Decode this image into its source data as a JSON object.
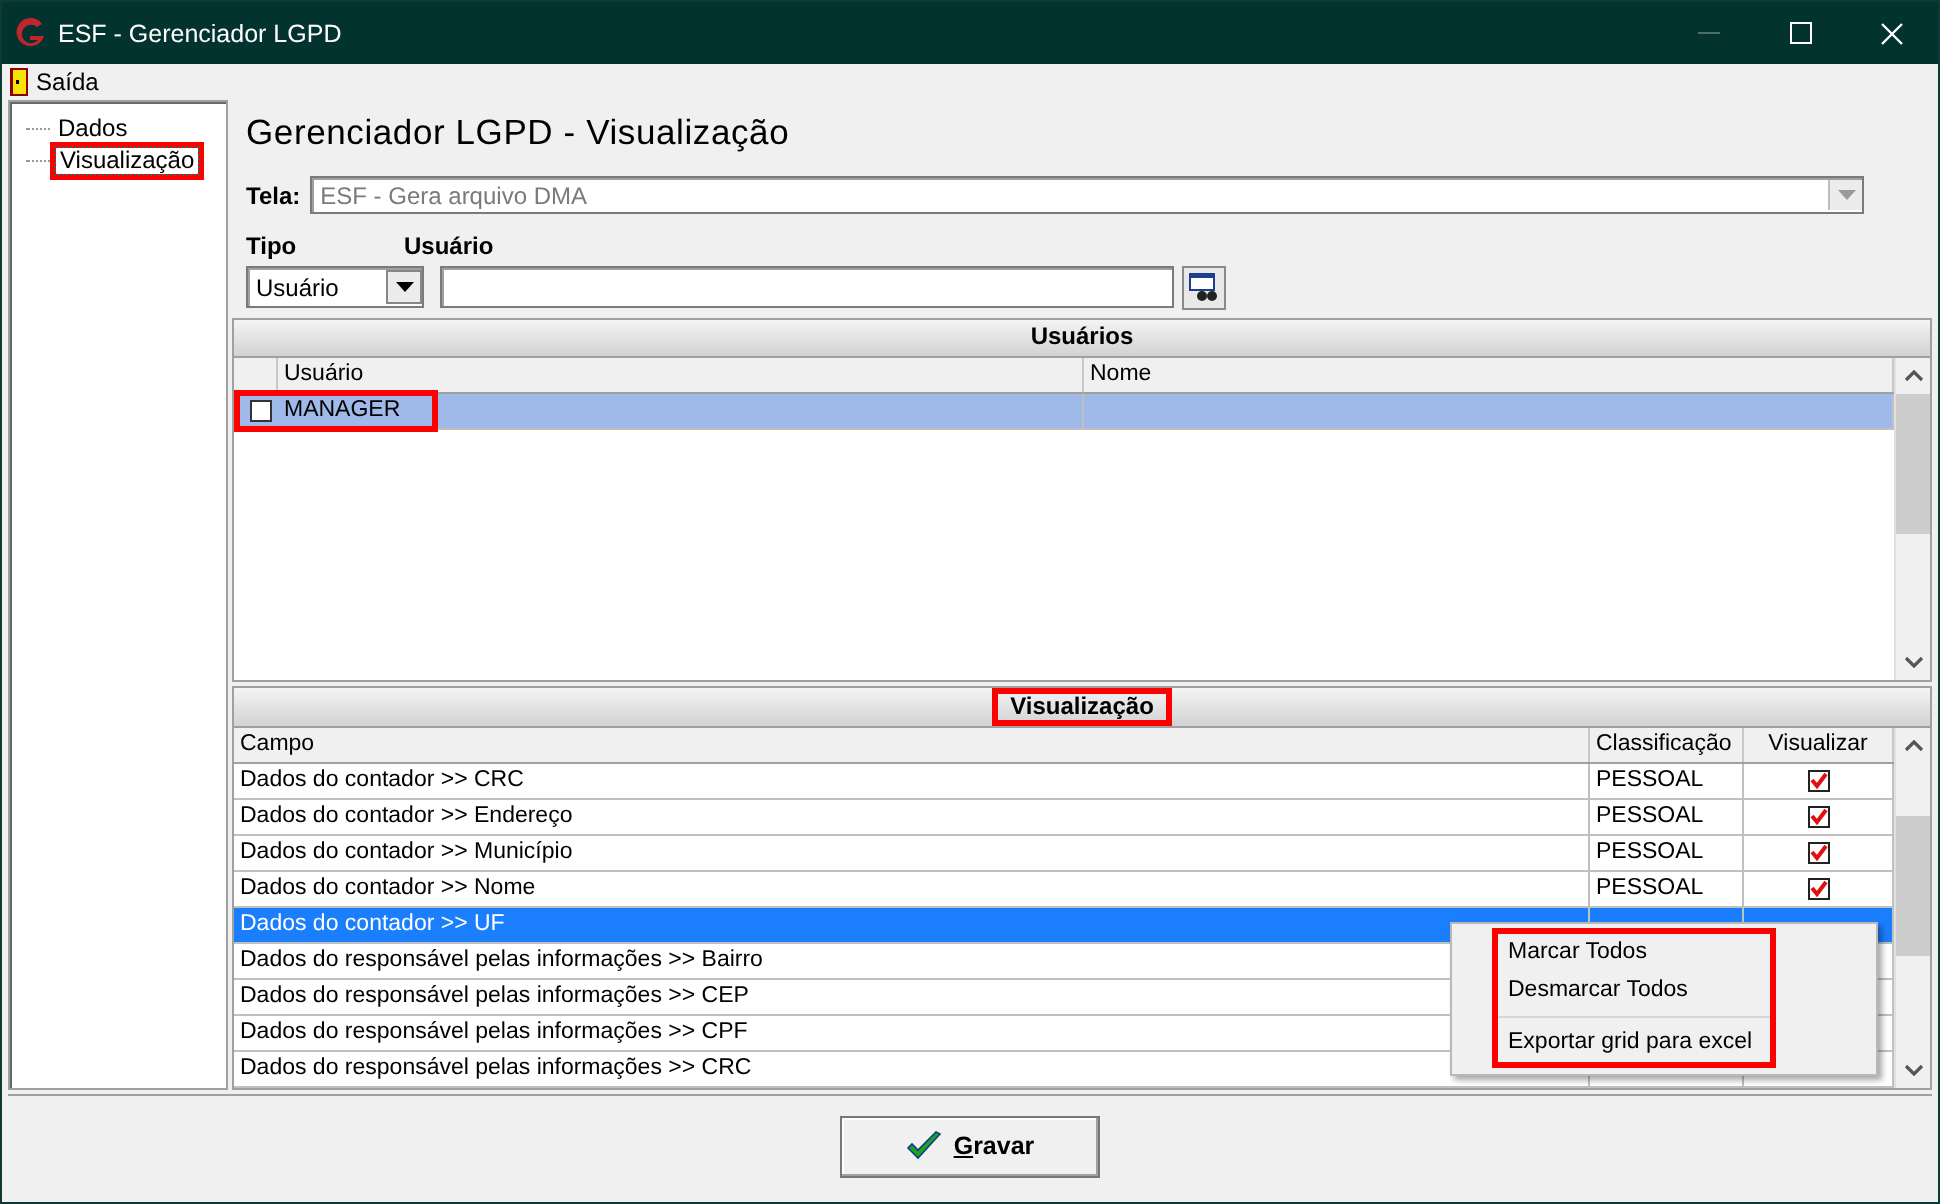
{
  "window": {
    "title": "ESF - Gerenciador LGPD"
  },
  "menu": [
    {
      "label": "Saída"
    }
  ],
  "tree": {
    "items": [
      {
        "label": "Dados",
        "selected": false,
        "highlighted": false
      },
      {
        "label": "Visualização",
        "selected": true,
        "highlighted": true
      }
    ]
  },
  "page_title": "Gerenciador LGPD - Visualização",
  "tela": {
    "label": "Tela:",
    "value": "ESF - Gera arquivo DMA",
    "disabled": true
  },
  "tipo": {
    "label": "Tipo",
    "value": "Usuário"
  },
  "usuario": {
    "label": "Usuário"
  },
  "users_grid": {
    "title": "Usuários",
    "columns": [
      "Usuário",
      "Nome"
    ],
    "rows": [
      {
        "usuario": "MANAGER",
        "checked": false,
        "selected": true,
        "highlighted": true
      }
    ]
  },
  "view_grid": {
    "title": "Visualização",
    "title_highlighted": true,
    "columns": [
      "Campo",
      "Classificação",
      "Visualizar"
    ],
    "rows": [
      {
        "campo": "Dados do contador >> CRC",
        "classificacao": "PESSOAL",
        "visualizar": true,
        "selected": false
      },
      {
        "campo": "Dados do contador >> Endereço",
        "classificacao": "PESSOAL",
        "visualizar": true,
        "selected": false
      },
      {
        "campo": "Dados do contador >> Município",
        "classificacao": "PESSOAL",
        "visualizar": true,
        "selected": false
      },
      {
        "campo": "Dados do contador >> Nome",
        "classificacao": "PESSOAL",
        "visualizar": true,
        "selected": false
      },
      {
        "campo": "Dados do contador >> UF",
        "selected": true
      },
      {
        "campo": "Dados do responsável pelas informações >> Bairro",
        "selected": false
      },
      {
        "campo": "Dados do responsável pelas informações >> CEP",
        "selected": false
      },
      {
        "campo": "Dados do responsável pelas informações >> CPF",
        "selected": false
      },
      {
        "campo": "Dados do responsável pelas informações >> CRC",
        "selected": false
      }
    ]
  },
  "context_menu": {
    "highlighted": true,
    "items": [
      {
        "kind": "item",
        "label": "Marcar Todos"
      },
      {
        "kind": "item",
        "label": "Desmarcar Todos"
      },
      {
        "kind": "separator"
      },
      {
        "kind": "item",
        "label": "Exportar grid para excel"
      }
    ]
  },
  "buttons": [
    {
      "label": "Gravar"
    }
  ]
}
